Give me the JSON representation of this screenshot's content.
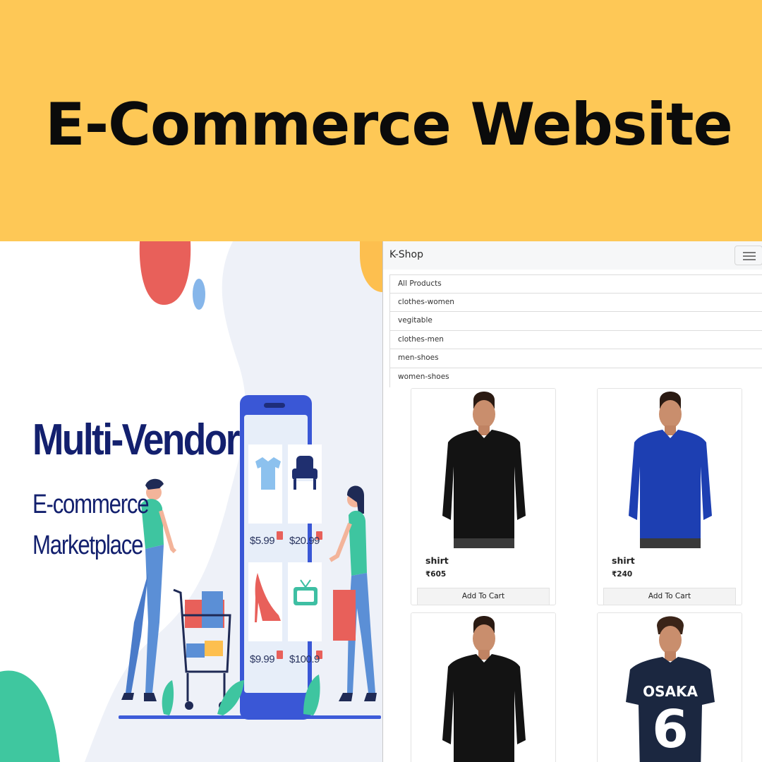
{
  "banner": {
    "title": "E-Commerce Website"
  },
  "illustration": {
    "title": "Multi-Vendor",
    "subtitle_line1": "E-commerce",
    "subtitle_line2": "Marketplace",
    "prices": [
      "$5.99",
      "$20.99",
      "$9.99",
      "$100.9"
    ],
    "tile_icons": [
      "tshirt-icon",
      "armchair-icon",
      "high-heel-icon",
      "tv-icon"
    ],
    "colors": {
      "title": "#13206e",
      "phone": "#3a57d6",
      "banner_bg": "#FEC856"
    }
  },
  "shop": {
    "brand": "K-Shop",
    "menu_icon": "hamburger-menu-icon",
    "categories": [
      "All Products",
      "clothes-women",
      "vegitable",
      "clothes-men",
      "men-shoes",
      "women-shoes"
    ],
    "products": [
      {
        "name": "shirt",
        "price": "₹605",
        "button": "Add To Cart",
        "shirt_color": "#131313"
      },
      {
        "name": "shirt",
        "price": "₹240",
        "button": "Add To Cart",
        "shirt_color": "#1d3fb2"
      },
      {
        "name": "",
        "price": "",
        "button": "",
        "shirt_color": "#131313"
      },
      {
        "name": "",
        "price": "",
        "button": "",
        "shirt_color": "#1b2740",
        "print": "OSAKA",
        "print_number": "6"
      }
    ]
  }
}
